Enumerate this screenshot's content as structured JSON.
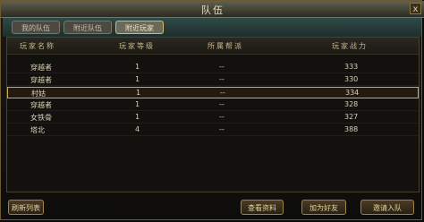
{
  "window": {
    "title": "队伍",
    "close_label": "x"
  },
  "tabs": [
    {
      "label": "我的队伍",
      "active": false
    },
    {
      "label": "附近队伍",
      "active": false
    },
    {
      "label": "附近玩家",
      "active": true
    }
  ],
  "table": {
    "headers": [
      "玩家名称",
      "玩家等级",
      "所属帮派",
      "玩家战力"
    ],
    "rows": [
      {
        "name": "穿越者",
        "level": "1",
        "guild": "--",
        "power": "333",
        "selected": false
      },
      {
        "name": "穿越者",
        "level": "1",
        "guild": "--",
        "power": "330",
        "selected": false
      },
      {
        "name": "村姑",
        "level": "1",
        "guild": "--",
        "power": "334",
        "selected": true
      },
      {
        "name": "穿越者",
        "level": "1",
        "guild": "--",
        "power": "328",
        "selected": false
      },
      {
        "name": "女铁骨",
        "level": "1",
        "guild": "--",
        "power": "327",
        "selected": false
      },
      {
        "name": "塔北",
        "level": "4",
        "guild": "--",
        "power": "388",
        "selected": false
      }
    ]
  },
  "buttons": {
    "refresh": "刷新列表",
    "view_info": "查看资料",
    "add_friend": "加为好友",
    "invite": "邀请入队"
  },
  "colors": {
    "accent": "#d2a84a",
    "frame": "#6e5a32"
  }
}
